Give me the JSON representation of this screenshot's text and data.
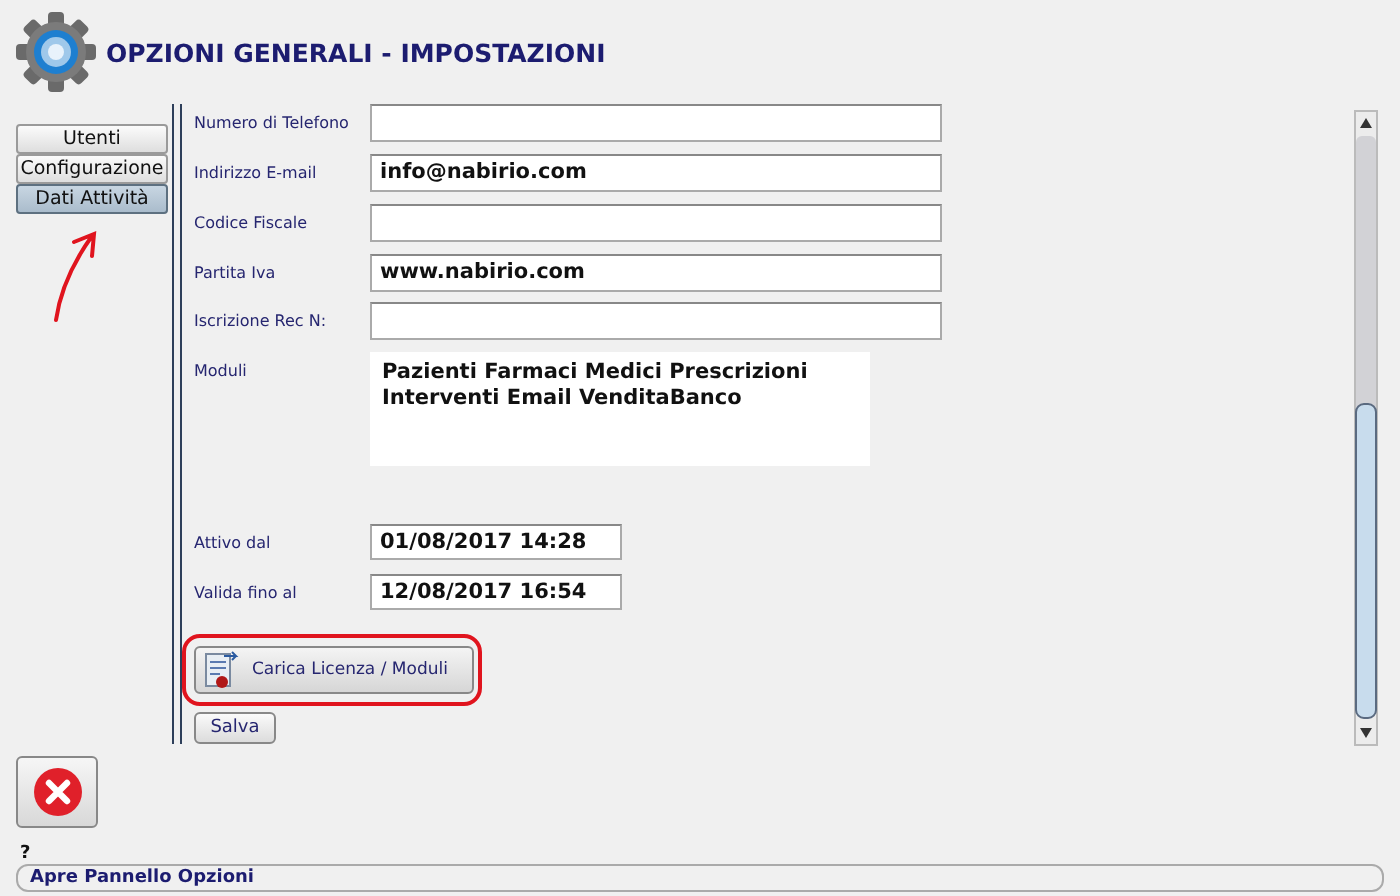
{
  "window": {
    "title": "OPZIONI GENERALI - IMPOSTAZIONI"
  },
  "tabs": [
    {
      "label": "Utenti",
      "selected": false
    },
    {
      "label": "Configurazione",
      "selected": false
    },
    {
      "label": "Dati Attività",
      "selected": true
    }
  ],
  "fields": [
    {
      "label": "Numero di Telefono",
      "kind": "line"
    },
    {
      "label": "Indirizzo E-mail",
      "value": "info@nabirio.com",
      "kind": "line"
    },
    {
      "label": "Codice Fiscale",
      "kind": "line"
    },
    {
      "label": "Partita Iva",
      "value": "www.nabirio.com",
      "kind": "line"
    },
    {
      "label": "Iscrizione Rec N:",
      "kind": "line"
    },
    {
      "label": "Moduli",
      "value": "Pazienti Farmaci Medici Prescrizioni\nInterventi Email VenditaBanco",
      "kind": "area"
    },
    {
      "label": "Attivo dal",
      "value": "01/08/2017 14:28",
      "kind": "date"
    },
    {
      "label": "Valida fino al",
      "value": "12/08/2017 16:54",
      "kind": "date"
    }
  ],
  "license_button": {
    "label": "Carica Licenza / Moduli",
    "highlighted": true
  },
  "save_button": {
    "label": "Salva"
  },
  "annotation_arrow": true,
  "help": "?",
  "status_bar": "Apre Pannello Opzioni"
}
